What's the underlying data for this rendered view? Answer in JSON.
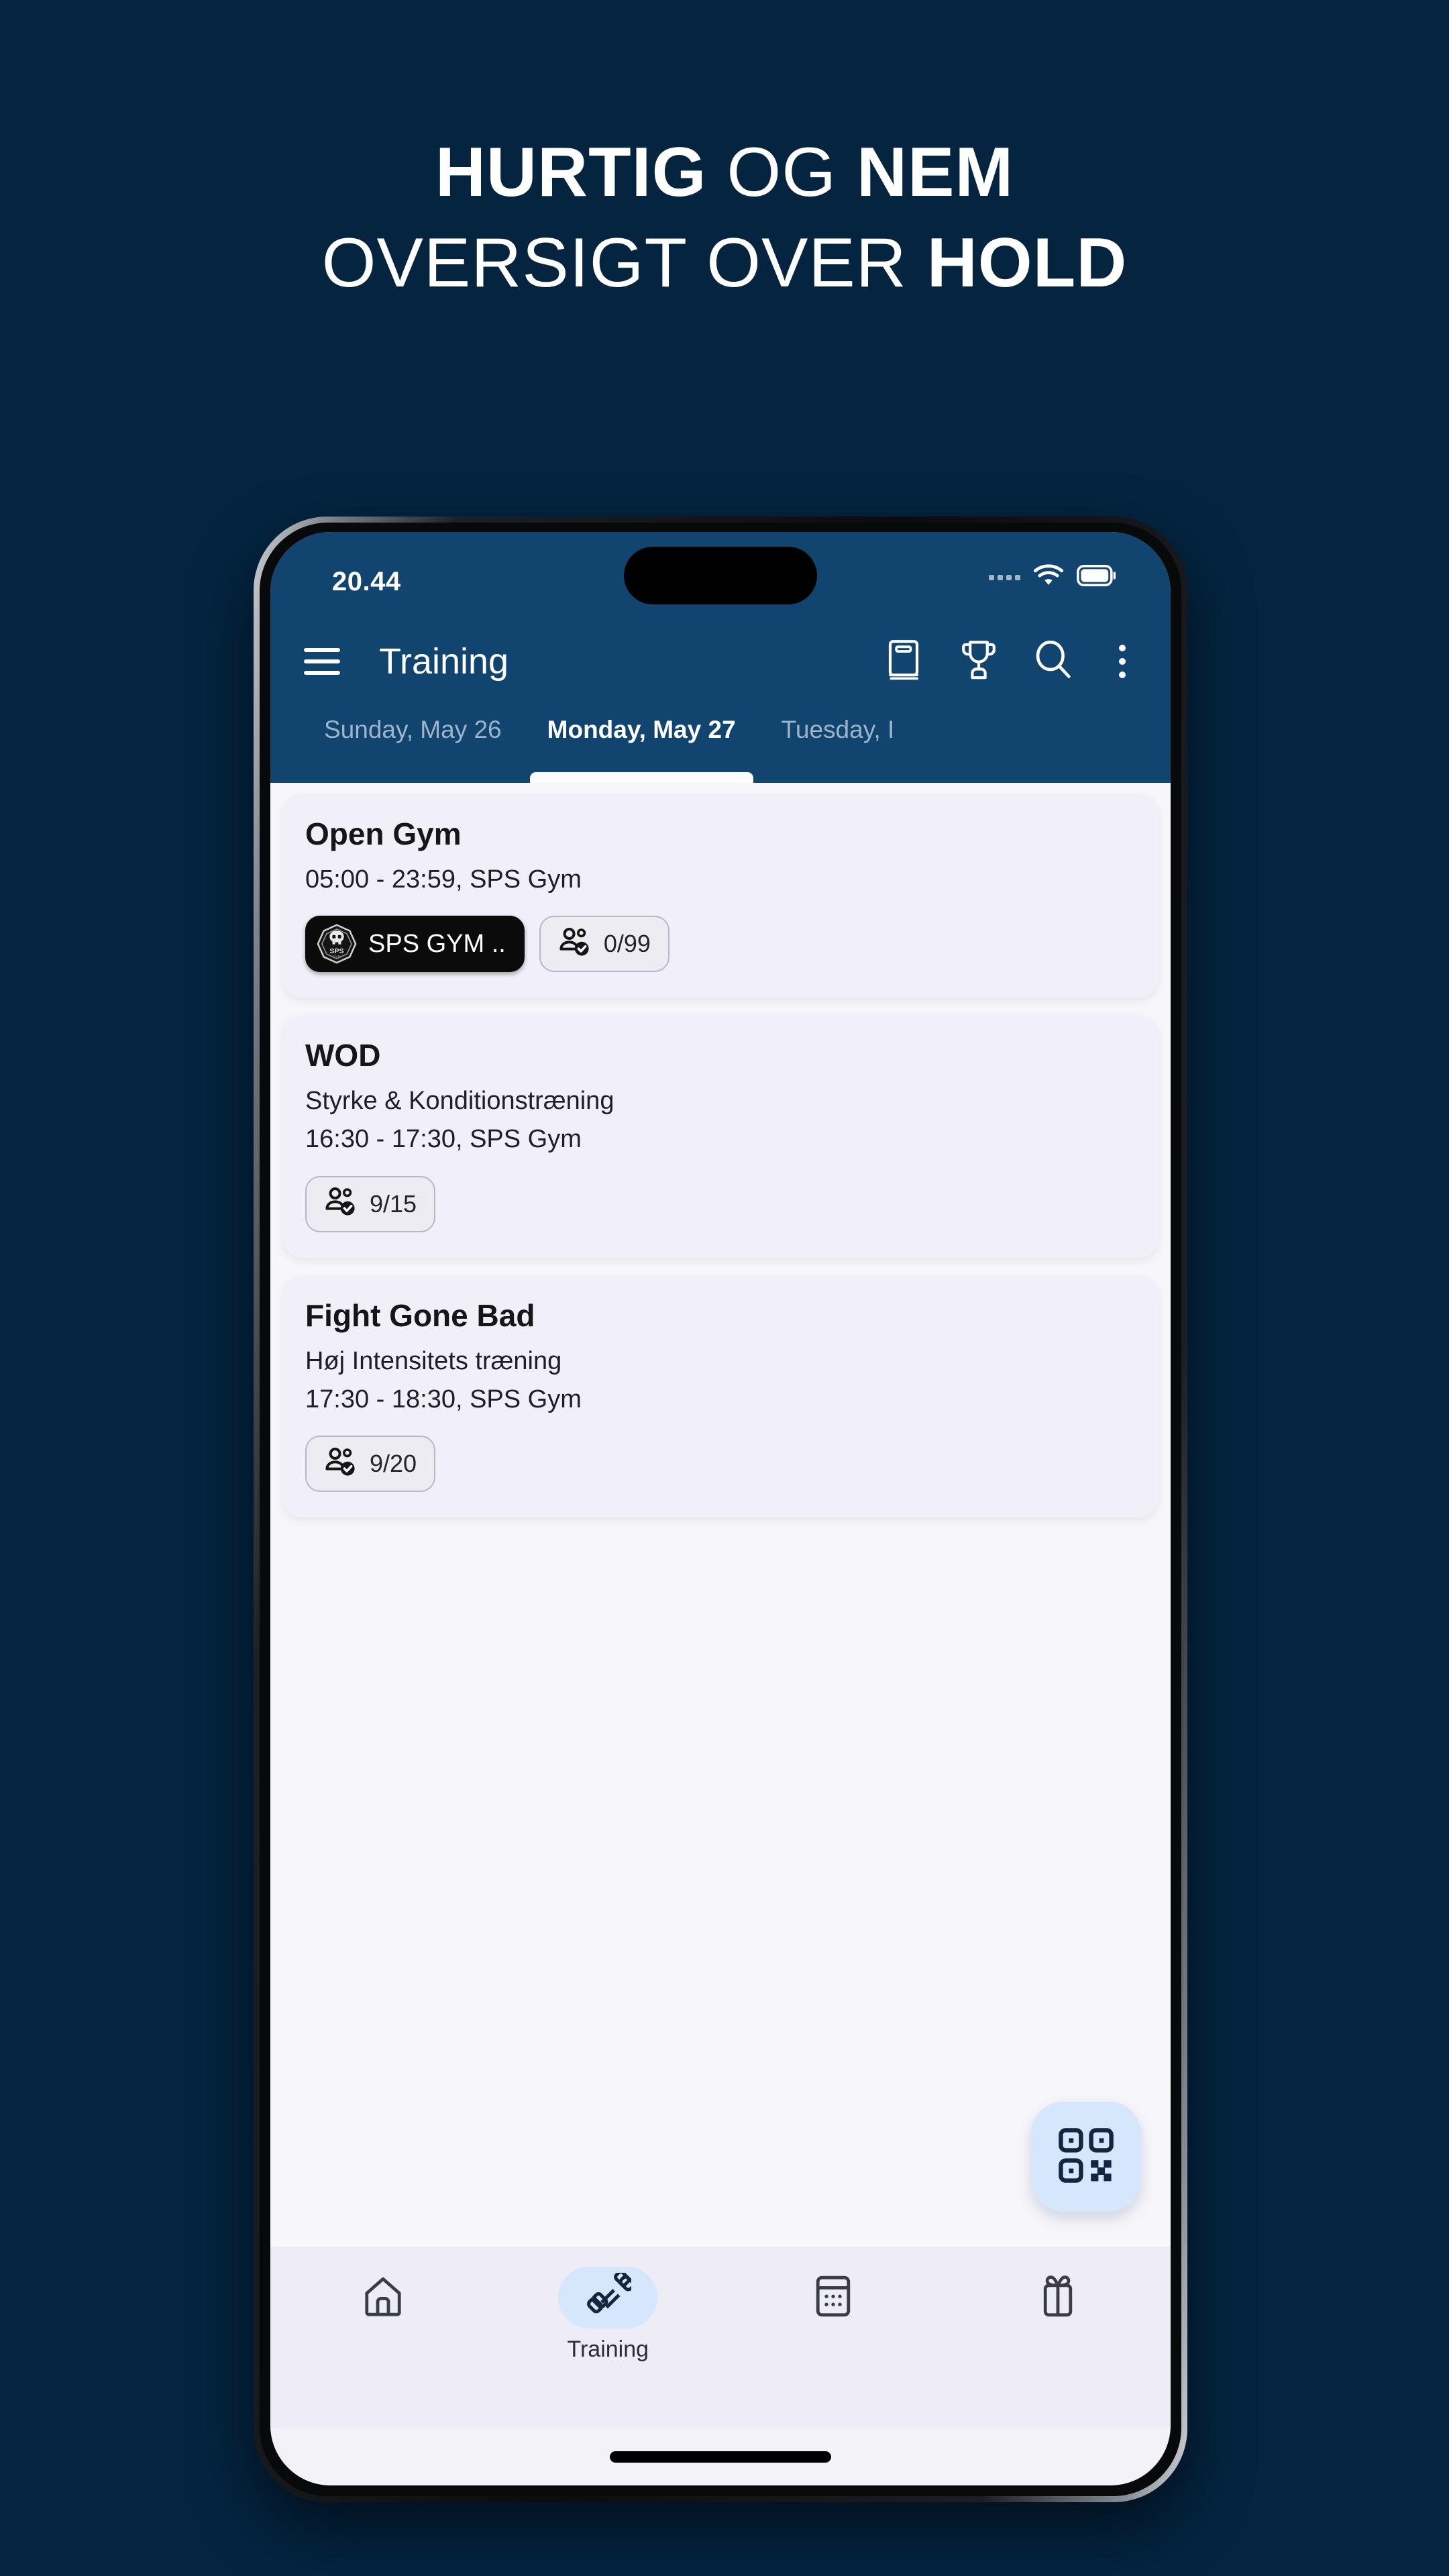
{
  "promo": {
    "line1_bold": "HURTIG",
    "line1_light": " OG ",
    "line1_bold2": "NEM",
    "line2_light": "OVERSIGT OVER ",
    "line2_bold": "HOLD"
  },
  "colors": {
    "page_background": "#042440",
    "app_header": "#124470",
    "content_background": "#f7f6fb",
    "card_background": "#f1f0f9",
    "accent_light_blue": "#d6e6fb",
    "icon_dark": "#12263f"
  },
  "status_bar": {
    "time": "20.44",
    "signal_icon": "signal-dots-icon",
    "wifi_icon": "wifi-icon",
    "battery_icon": "battery-icon"
  },
  "app_bar": {
    "menu_icon": "hamburger-menu-icon",
    "title": "Training",
    "actions": [
      {
        "icon": "book-icon"
      },
      {
        "icon": "trophy-icon"
      },
      {
        "icon": "search-icon"
      },
      {
        "icon": "overflow-menu-icon"
      }
    ]
  },
  "date_tabs": [
    {
      "label": "Sunday, May 26",
      "active": false
    },
    {
      "label": "Monday, May 27",
      "active": true
    },
    {
      "label": "Tuesday, I",
      "active": false
    }
  ],
  "classes": [
    {
      "title": "Open Gym",
      "description": null,
      "schedule": "05:00 - 23:59, SPS Gym",
      "brand_chip": {
        "label": "SPS GYM ..",
        "logo_icon": "sps-gym-logo-icon"
      },
      "attendance": {
        "icon": "people-check-icon",
        "value": "0/99"
      }
    },
    {
      "title": "WOD",
      "description": "Styrke & Konditionstræning",
      "schedule": "16:30 - 17:30, SPS Gym",
      "brand_chip": null,
      "attendance": {
        "icon": "people-check-icon",
        "value": "9/15"
      }
    },
    {
      "title": "Fight Gone Bad",
      "description": "Høj Intensitets træning",
      "schedule": "17:30 - 18:30, SPS Gym",
      "brand_chip": null,
      "attendance": {
        "icon": "people-check-icon",
        "value": "9/20"
      }
    }
  ],
  "fab": {
    "icon": "qr-code-icon"
  },
  "bottom_nav": [
    {
      "icon": "home-icon",
      "label": "",
      "active": false
    },
    {
      "icon": "dumbbell-icon",
      "label": "Training",
      "active": true
    },
    {
      "icon": "calendar-icon",
      "label": "",
      "active": false
    },
    {
      "icon": "gift-icon",
      "label": "",
      "active": false
    }
  ]
}
